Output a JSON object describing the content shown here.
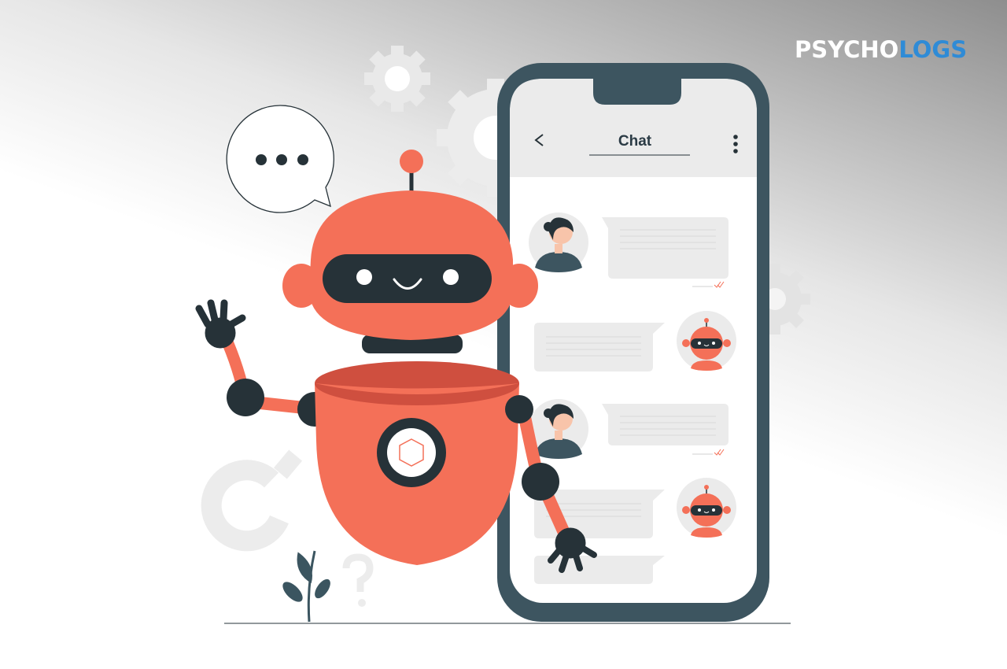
{
  "brand": {
    "part1": "PSYCHO",
    "part2": "LOGS"
  },
  "phone": {
    "title": "Chat",
    "back_icon": "chevron-left-icon",
    "menu_icon": "vertical-dots-icon"
  },
  "messages": [
    {
      "sender": "user",
      "avatar_icon": "woman-avatar-icon",
      "read_icon": "double-check-icon"
    },
    {
      "sender": "bot",
      "avatar_icon": "robot-avatar-icon"
    },
    {
      "sender": "user",
      "avatar_icon": "woman-avatar-icon",
      "read_icon": "double-check-icon"
    },
    {
      "sender": "bot",
      "avatar_icon": "robot-avatar-icon"
    },
    {
      "sender": "bot",
      "avatar_icon": ""
    }
  ],
  "colors": {
    "robot": "#f47058",
    "robot_dark": "#263238",
    "phone_frame": "#3d5560",
    "bubble": "#ebebeb",
    "brand_blue": "#2f8bd6"
  }
}
